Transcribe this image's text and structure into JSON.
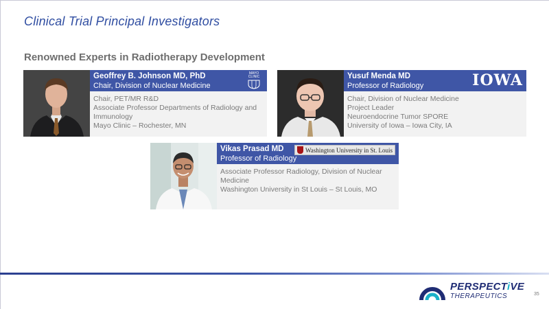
{
  "title": "Clinical Trial Principal Investigators",
  "subtitle": "Renowned Experts in Radiotherapy Development",
  "investigators": [
    {
      "name": "Geoffrey B. Johnson MD, PhD",
      "title": "Chair, Division of Nuclear Medicine",
      "details": [
        "Chair, PET/MR R&D",
        "Associate Professor Departments of Radiology and",
        "Immunology",
        "Mayo Clinic – Rochester, MN"
      ],
      "logo": {
        "line1": "MAYO",
        "line2": "CLINIC",
        "icon": "mayo-clinic-shield-icon"
      }
    },
    {
      "name": "Yusuf Menda MD",
      "title": "Professor of Radiology",
      "details": [
        "Chair, Division of Nuclear Medicine",
        "Project Leader",
        "Neuroendocrine Tumor SPORE",
        "University of Iowa – Iowa City, IA"
      ],
      "logo": {
        "text": "IOWA"
      }
    },
    {
      "name": "Vikas Prasad MD",
      "title": "Professor of Radiology",
      "details": [
        "Associate Professor Radiology, Division of Nuclear",
        "Medicine",
        "Washington University in St Louis – St Louis, MO"
      ],
      "logo": {
        "text": "Washington University in St. Louis",
        "icon": "washu-shield-icon"
      }
    }
  ],
  "brand": {
    "name_part1": "PERSPECT",
    "name_accent": "i",
    "name_part2": "VE",
    "sub": "THERAPEUTICS"
  },
  "page_number": "35",
  "colors": {
    "title": "#2f4da1",
    "header_bg": "#3f56a6",
    "body_bg": "#f2f2f2",
    "brand_navy": "#1f2c74",
    "brand_teal": "#1bb1c9"
  }
}
